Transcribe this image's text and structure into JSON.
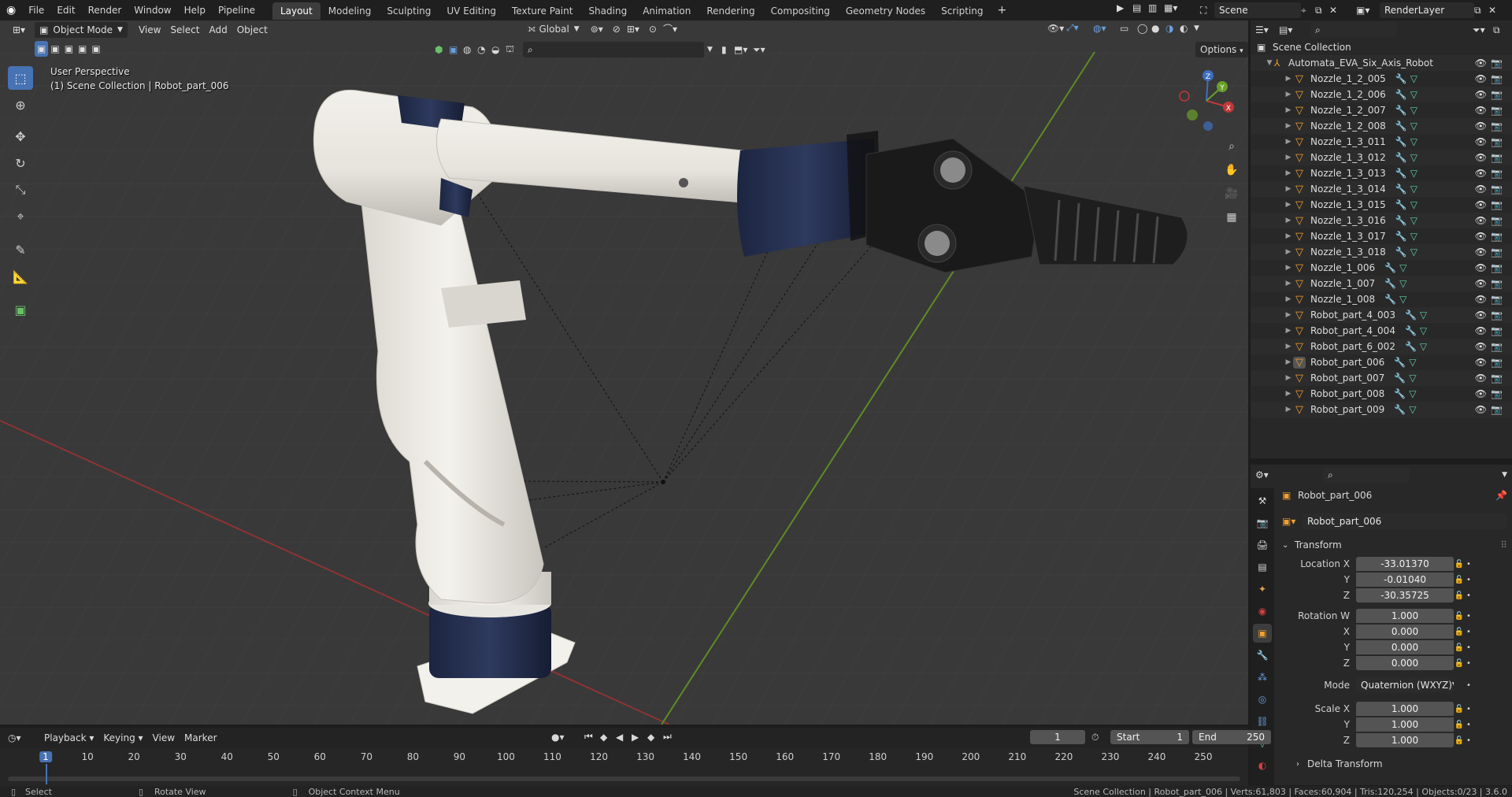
{
  "menu": {
    "items": [
      "File",
      "Edit",
      "Render",
      "Window",
      "Help",
      "Pipeline"
    ],
    "workspaces": [
      "Layout",
      "Modeling",
      "Sculpting",
      "UV Editing",
      "Texture Paint",
      "Shading",
      "Animation",
      "Rendering",
      "Compositing",
      "Geometry Nodes",
      "Scripting"
    ],
    "active_workspace": "Layout",
    "scene": "Scene",
    "render_layer": "RenderLayer"
  },
  "viewport": {
    "mode": "Object Mode",
    "menus": [
      "View",
      "Select",
      "Add",
      "Object"
    ],
    "orientation": "Global",
    "options_label": "Options",
    "perspective_label": "User Perspective",
    "collection_label": "(1) Scene Collection | Robot_part_006",
    "axis_labels": {
      "z": "Z",
      "y": "Y",
      "x": "X"
    }
  },
  "outliner": {
    "root": "Scene Collection",
    "collection": "Automata_EVA_Six_Axis_Robot",
    "items": [
      "Nozzle_1_2_005",
      "Nozzle_1_2_006",
      "Nozzle_1_2_007",
      "Nozzle_1_2_008",
      "Nozzle_1_3_011",
      "Nozzle_1_3_012",
      "Nozzle_1_3_013",
      "Nozzle_1_3_014",
      "Nozzle_1_3_015",
      "Nozzle_1_3_016",
      "Nozzle_1_3_017",
      "Nozzle_1_3_018",
      "Nozzle_1_006",
      "Nozzle_1_007",
      "Nozzle_1_008",
      "Robot_part_4_003",
      "Robot_part_4_004",
      "Robot_part_6_002",
      "Robot_part_006",
      "Robot_part_007",
      "Robot_part_008",
      "Robot_part_009"
    ],
    "active_item": "Robot_part_006"
  },
  "properties": {
    "object_name": "Robot_part_006",
    "data_name": "Robot_part_006",
    "panel_title": "Transform",
    "location": {
      "label": "Location X",
      "x": "-33.01370",
      "y": "-0.01040",
      "z": "-30.35725"
    },
    "rotation": {
      "label": "Rotation W",
      "w": "1.000",
      "x": "0.000",
      "y": "0.000",
      "z": "0.000"
    },
    "axis_y": "Y",
    "axis_x": "X",
    "axis_z": "Z",
    "mode_label": "Mode",
    "mode_value": "Quaternion (WXYZ)",
    "scale": {
      "label": "Scale X",
      "x": "1.000",
      "y": "1.000",
      "z": "1.000"
    },
    "delta_label": "Delta Transform"
  },
  "timeline": {
    "menus": [
      "Playback",
      "Keying",
      "View",
      "Marker"
    ],
    "current_frame": "1",
    "start_label": "Start",
    "start": "1",
    "end_label": "End",
    "end": "250",
    "ticks": [
      "1",
      "10",
      "20",
      "30",
      "40",
      "50",
      "60",
      "70",
      "80",
      "90",
      "100",
      "110",
      "120",
      "130",
      "140",
      "150",
      "160",
      "170",
      "180",
      "190",
      "200",
      "210",
      "220",
      "230",
      "240",
      "250"
    ]
  },
  "statusbar": {
    "select": "Select",
    "rotate": "Rotate View",
    "context": "Object Context Menu",
    "stats": "Scene Collection | Robot_part_006 | Verts:61,803 | Faces:60,904 | Tris:120,254 | Objects:0/23 | 3.6.0"
  },
  "colors": {
    "accent": "#4772b3",
    "mesh_icon": "#f0a030",
    "grid_red": "#a33a3a",
    "grid_green": "#6a9a2a"
  }
}
